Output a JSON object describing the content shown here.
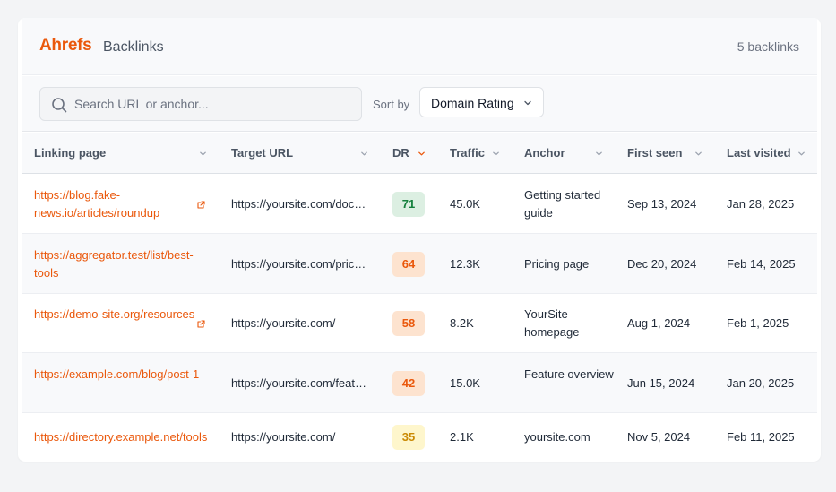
{
  "header": {
    "logo": "Ahrefs",
    "title": "Backlinks",
    "count": "5 backlinks"
  },
  "toolbar": {
    "search_placeholder": "Search URL or anchor...",
    "sort_label": "Sort by",
    "sort_value": "Domain Rating"
  },
  "columns": [
    "Linking page",
    "Target URL",
    "DR",
    "Traffic",
    "Anchor",
    "First seen",
    "Last visited"
  ],
  "sorted_column": "DR",
  "rows": [
    {
      "linking": "https://blog.fake-news.io/articles/roundup",
      "target": "https://yoursite.com/docs/getting-started",
      "dr": "71",
      "dr_bg": "#dcefe2",
      "dr_color": "#15803d",
      "traffic": "45.0K",
      "anchor": "Getting started guide",
      "first_seen": "Sep 13, 2024",
      "last_visited": "Jan 28, 2025"
    },
    {
      "linking": "https://aggregator.test/list/best-tools",
      "target": "https://yoursite.com/pricing",
      "dr": "64",
      "dr_bg": "#fde3cf",
      "dr_color": "#ea580c",
      "traffic": "12.3K",
      "anchor": "Pricing page",
      "first_seen": "Dec 20, 2024",
      "last_visited": "Feb 14, 2025"
    },
    {
      "linking": "https://demo-site.org/resources",
      "target": "https://yoursite.com/",
      "dr": "58",
      "dr_bg": "#fde3cf",
      "dr_color": "#ea580c",
      "traffic": "8.2K",
      "anchor": "YourSite homepage",
      "first_seen": "Aug 1, 2024",
      "last_visited": "Feb 1, 2025"
    },
    {
      "linking": "https://example.com/blog/post-1",
      "target": "https://yoursite.com/features",
      "dr": "42",
      "dr_bg": "#fde3cf",
      "dr_color": "#ea580c",
      "traffic": "15.0K",
      "anchor": "Feature overview",
      "first_seen": "Jun 15, 2024",
      "last_visited": "Jan 20, 2025"
    },
    {
      "linking": "https://directory.example.net/tools",
      "target": "https://yoursite.com/",
      "dr": "35",
      "dr_bg": "#fef6cc",
      "dr_color": "#ca8a04",
      "traffic": "2.1K",
      "anchor": "yoursite.com",
      "first_seen": "Nov 5, 2024",
      "last_visited": "Feb 11, 2025"
    }
  ],
  "colors": {
    "accent": "#ea580c",
    "chevron": "#9ca3af"
  }
}
